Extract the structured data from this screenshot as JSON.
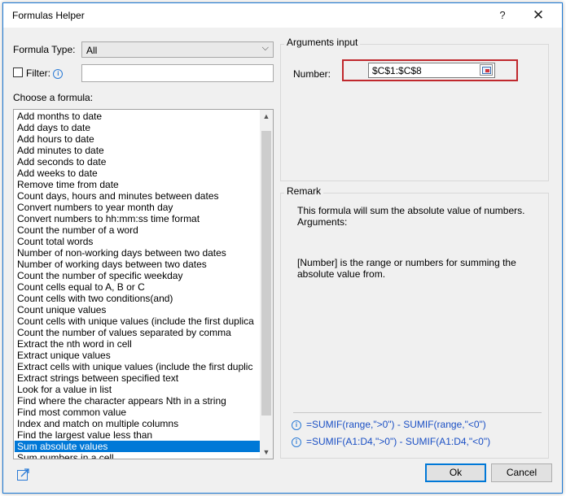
{
  "window": {
    "title": "Formulas Helper",
    "help_label": "?",
    "close_label": "✕"
  },
  "left": {
    "formula_type_label": "Formula Type:",
    "formula_type_value": "All",
    "filter_label": "Filter:",
    "filter_value": "",
    "choose_label": "Choose a formula:",
    "formulas": [
      "Add months to date",
      "Add days to date",
      "Add hours to date",
      "Add minutes to date",
      "Add seconds to date",
      "Add weeks to date",
      "Remove time from date",
      "Count days, hours and minutes between dates",
      "Convert numbers to year month day",
      "Convert numbers to hh:mm:ss time format",
      "Count the number of a word",
      "Count total words",
      "Number of non-working days between two dates",
      "Number of working days between two dates",
      "Count the number of specific weekday",
      "Count cells equal to A, B or C",
      "Count cells with two conditions(and)",
      "Count unique values",
      "Count cells with unique values (include the first duplica",
      "Count the number of values separated by comma",
      "Extract the nth word in cell",
      "Extract unique values",
      "Extract cells with unique values (include the first duplic",
      "Extract strings between specified text",
      "Look for a value in list",
      "Find where the character appears Nth in a string",
      "Find most common value",
      "Index and match on multiple columns",
      "Find the largest value less than",
      "Sum absolute values",
      "Sum numbers in a cell"
    ],
    "selected_index": 29
  },
  "arguments": {
    "title": "Arguments input",
    "number_label": "Number:",
    "number_value": "$C$1:$C$8"
  },
  "remark": {
    "title": "Remark",
    "line1": "This formula will sum the absolute value of numbers.",
    "line2": "Arguments:",
    "line3": "[Number] is the range or numbers for summing the",
    "line4": "absolute value from.",
    "example1": "=SUMIF(range,\">0\") - SUMIF(range,\"<0\")",
    "example2": "=SUMIF(A1:D4,\">0\") - SUMIF(A1:D4,\"<0\")"
  },
  "footer": {
    "ok_label": "Ok",
    "cancel_label": "Cancel"
  },
  "colors": {
    "selection": "#0078d7",
    "highlight_border": "#c0282d",
    "example_text": "#1a4fc4"
  }
}
